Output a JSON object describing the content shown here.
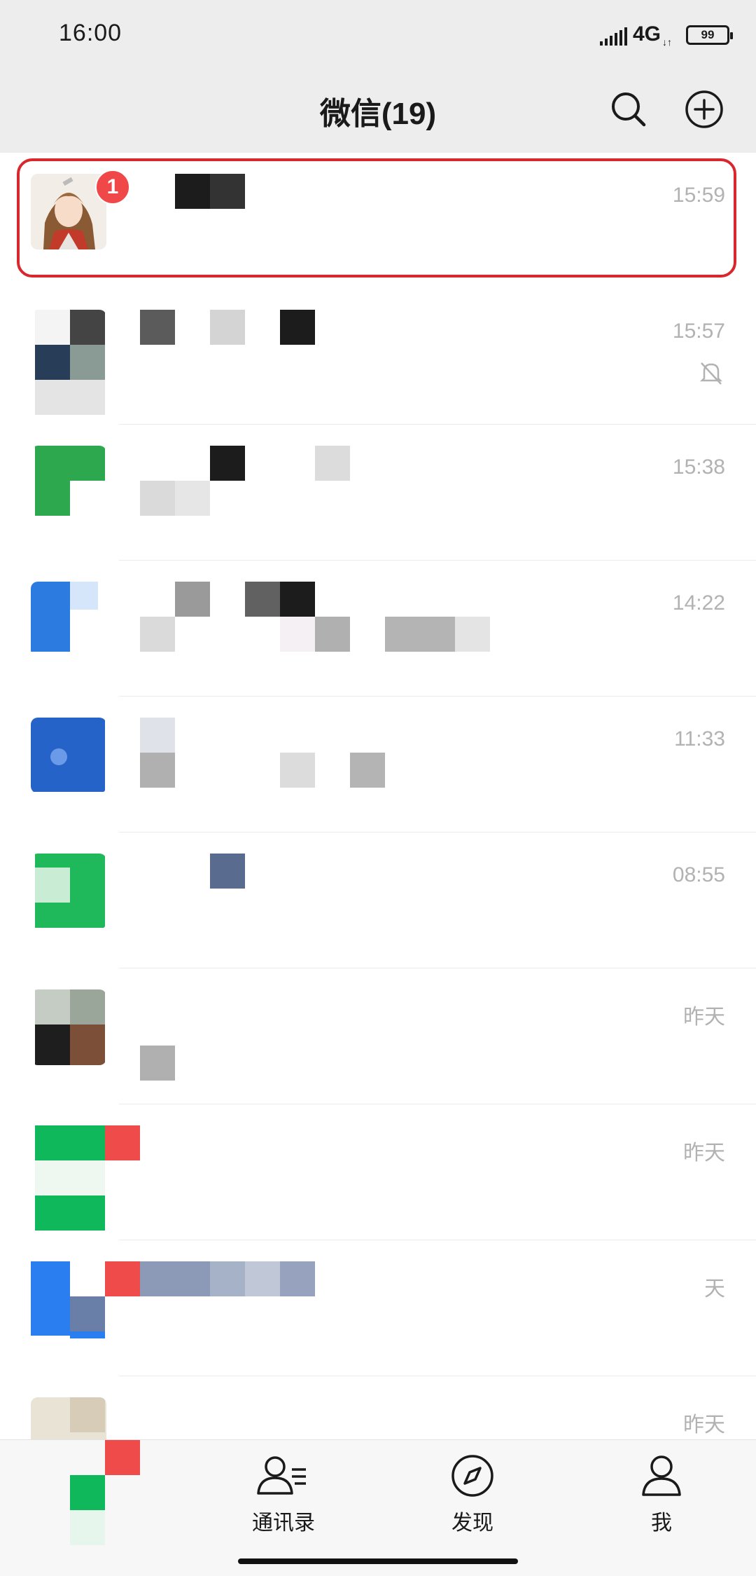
{
  "status_bar": {
    "time": "16:00",
    "network": "4G",
    "network_arrows": "↓↑",
    "battery": "99"
  },
  "header": {
    "title": "微信(19)",
    "search_icon": "search-icon",
    "add_icon": "plus-circle-icon"
  },
  "chats": [
    {
      "time": "15:59",
      "unread": "1",
      "muted": false,
      "highlighted": true
    },
    {
      "time": "15:57",
      "muted": true
    },
    {
      "time": "15:38",
      "muted": false
    },
    {
      "time": "14:22",
      "muted": false
    },
    {
      "time": "11:33",
      "muted": false
    },
    {
      "time": "08:55",
      "muted": false
    },
    {
      "time": "昨天",
      "muted": false
    },
    {
      "time": "昨天",
      "muted": false
    },
    {
      "time": "天",
      "muted": false
    },
    {
      "time": "昨天",
      "muted": false
    }
  ],
  "tabbar": {
    "tabs": [
      {
        "label": "通讯录",
        "icon": "contacts-icon"
      },
      {
        "label": "发现",
        "icon": "compass-icon"
      },
      {
        "label": "我",
        "icon": "person-icon"
      }
    ]
  },
  "colors": {
    "highlight": "#d9272e",
    "badge": "#f04848",
    "background": "#ededed"
  }
}
